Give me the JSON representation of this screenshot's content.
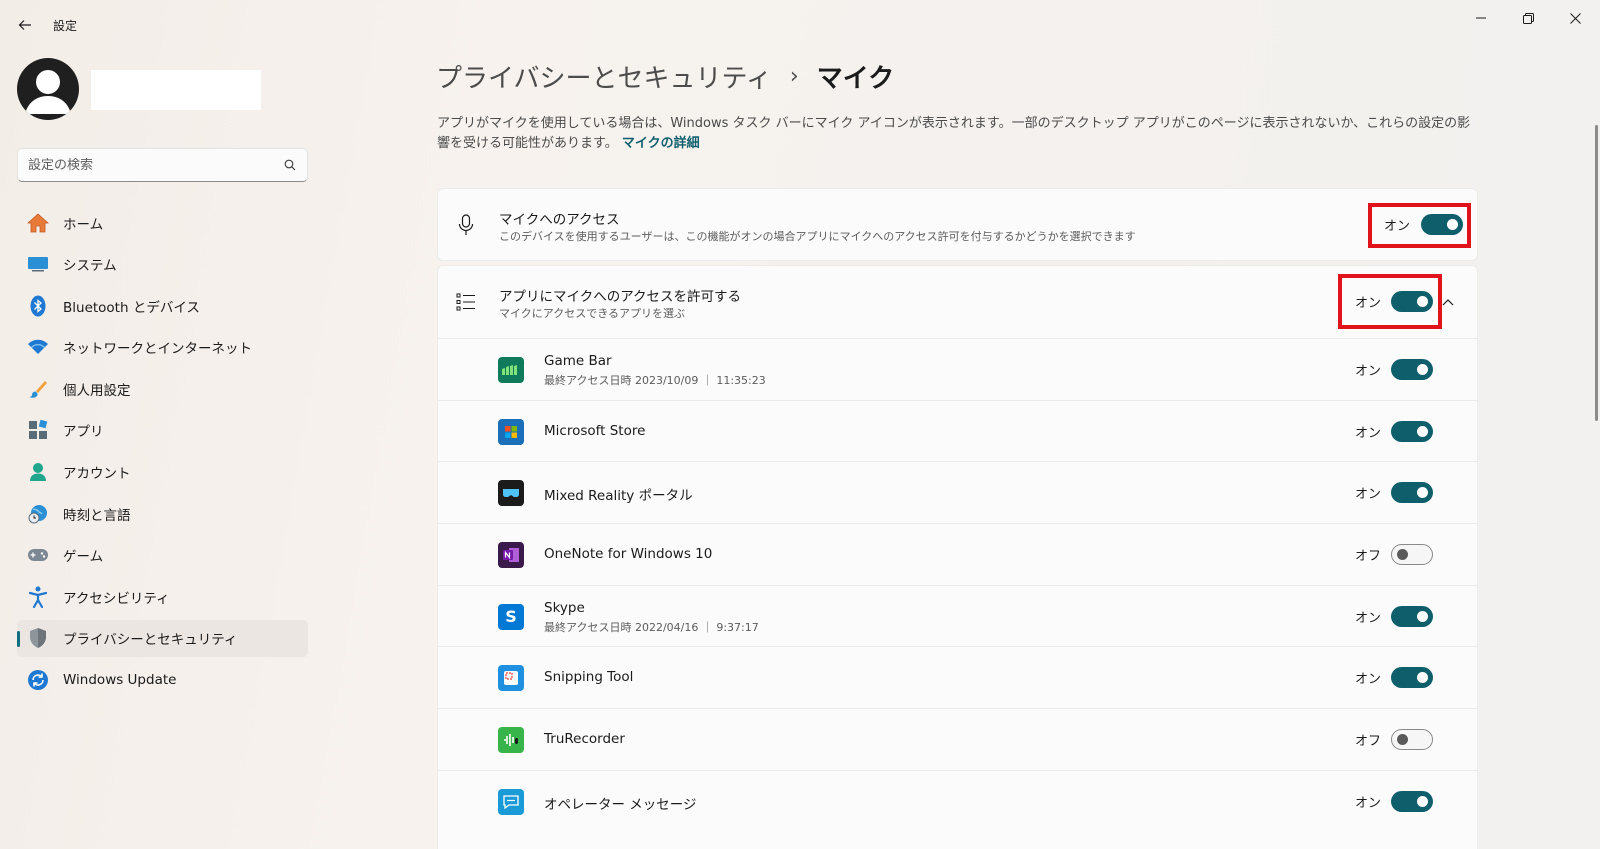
{
  "window": {
    "title": "設定"
  },
  "search": {
    "placeholder": "設定の検索"
  },
  "sidebar": {
    "items": [
      {
        "label": "ホーム",
        "icon": "home-icon"
      },
      {
        "label": "システム",
        "icon": "system-icon"
      },
      {
        "label": "Bluetooth とデバイス",
        "icon": "bluetooth-icon"
      },
      {
        "label": "ネットワークとインターネット",
        "icon": "wifi-icon"
      },
      {
        "label": "個人用設定",
        "icon": "brush-icon"
      },
      {
        "label": "アプリ",
        "icon": "apps-icon"
      },
      {
        "label": "アカウント",
        "icon": "account-icon"
      },
      {
        "label": "時刻と言語",
        "icon": "globe-clock-icon"
      },
      {
        "label": "ゲーム",
        "icon": "gamepad-icon"
      },
      {
        "label": "アクセシビリティ",
        "icon": "accessibility-icon"
      },
      {
        "label": "プライバシーとセキュリティ",
        "icon": "shield-icon",
        "active": true
      },
      {
        "label": "Windows Update",
        "icon": "update-icon"
      }
    ]
  },
  "breadcrumb": {
    "parent": "プライバシーとセキュリティ",
    "separator": "›",
    "current": "マイク"
  },
  "description": {
    "text": "アプリがマイクを使用している場合は、Windows タスク バーにマイク アイコンが表示されます。一部のデスクトップ アプリがこのページに表示されないか、これらの設定の影響を受ける可能性があります。",
    "link": "マイクの詳細"
  },
  "mic_access": {
    "title": "マイクへのアクセス",
    "subtitle": "このデバイスを使用するユーザーは、この機能がオンの場合アプリにマイクへのアクセス許可を付与するかどうかを選択できます",
    "state_label": "オン",
    "on": true
  },
  "app_access": {
    "title": "アプリにマイクへのアクセスを許可する",
    "subtitle": "マイクにアクセスできるアプリを選ぶ",
    "state_label": "オン",
    "on": true,
    "expanded": true
  },
  "apps": [
    {
      "name": "Game Bar",
      "sub": "最終アクセス日時 2023/10/09 ｜ 11:35:23",
      "state_label": "オン",
      "on": true,
      "icon": "game-bar-icon"
    },
    {
      "name": "Microsoft Store",
      "sub": "",
      "state_label": "オン",
      "on": true,
      "icon": "microsoft-store-icon"
    },
    {
      "name": "Mixed Reality ポータル",
      "sub": "",
      "state_label": "オン",
      "on": true,
      "icon": "mixed-reality-icon"
    },
    {
      "name": "OneNote for Windows 10",
      "sub": "",
      "state_label": "オフ",
      "on": false,
      "icon": "onenote-icon"
    },
    {
      "name": "Skype",
      "sub": "最終アクセス日時 2022/04/16 ｜ 9:37:17",
      "state_label": "オン",
      "on": true,
      "icon": "skype-icon"
    },
    {
      "name": "Snipping Tool",
      "sub": "",
      "state_label": "オン",
      "on": true,
      "icon": "snipping-tool-icon"
    },
    {
      "name": "TruRecorder",
      "sub": "",
      "state_label": "オフ",
      "on": false,
      "icon": "trurecorder-icon"
    },
    {
      "name": "オペレーター メッセージ",
      "sub": "",
      "state_label": "オン",
      "on": true,
      "icon": "operator-messages-icon"
    }
  ],
  "colors": {
    "accent": "#0f5e6c",
    "highlight": "#e0121b"
  }
}
